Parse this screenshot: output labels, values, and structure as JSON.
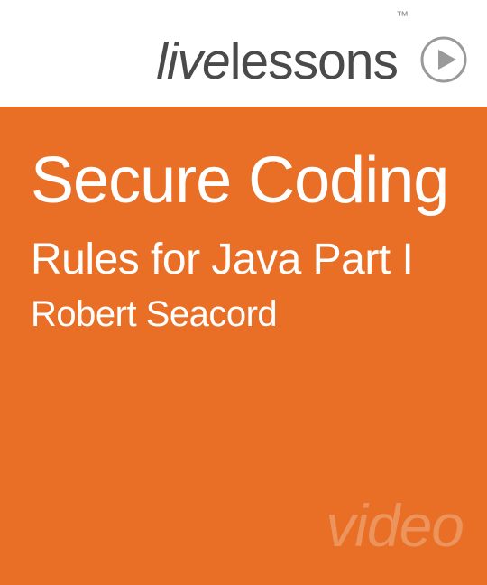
{
  "brand": {
    "live": "live",
    "lessons": "lessons",
    "tm": "™",
    "play_icon": "play-icon"
  },
  "title": "Secure Coding",
  "subtitle": "Rules for Java Part I",
  "author": "Robert Seacord",
  "video_label": "video"
}
